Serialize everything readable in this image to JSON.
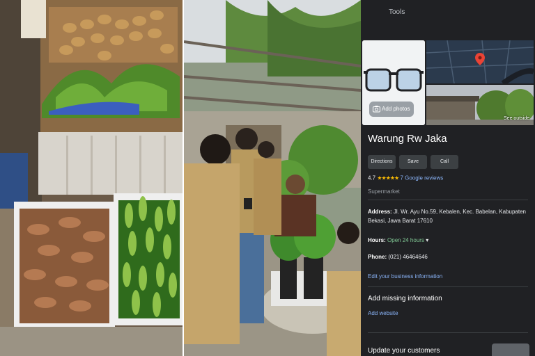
{
  "maps_panel": {
    "header": {
      "tools_label": "Tools"
    },
    "photos": {
      "add_photo_label": "Add photos",
      "see_outside_label": "See outside"
    },
    "business": {
      "name": "Warung Rw Jaka",
      "actions": [
        {
          "label": "Directions"
        },
        {
          "label": "Save"
        },
        {
          "label": "Call"
        }
      ],
      "rating": "4.7",
      "stars": "★★★★★",
      "review_count_label": "7 Google reviews",
      "category": "Supermarket",
      "address_label": "Address:",
      "address_value": "Jl. Wr. Ayu No.59, Kebalen, Kec. Babelan, Kabupaten Bekasi, Jawa Barat 17610",
      "hours_label": "Hours:",
      "hours_value": "Open 24 hours",
      "hours_caret": "▾",
      "phone_label": "Phone:",
      "phone_value": "(021) 46464646",
      "edit_info_link": "Edit your business information",
      "missing_info_heading": "Add missing information",
      "add_website_link": "Add website",
      "update_customers_heading": "Update your customers"
    },
    "colors": {
      "panel_bg": "#202124",
      "link": "#8ab4f8",
      "stars": "#fbbc04",
      "open_status": "#81c995",
      "map_pin": "#ea4335"
    }
  },
  "photos": [
    {
      "subject": "market-produce-photo"
    },
    {
      "subject": "garden-group-photo"
    }
  ]
}
